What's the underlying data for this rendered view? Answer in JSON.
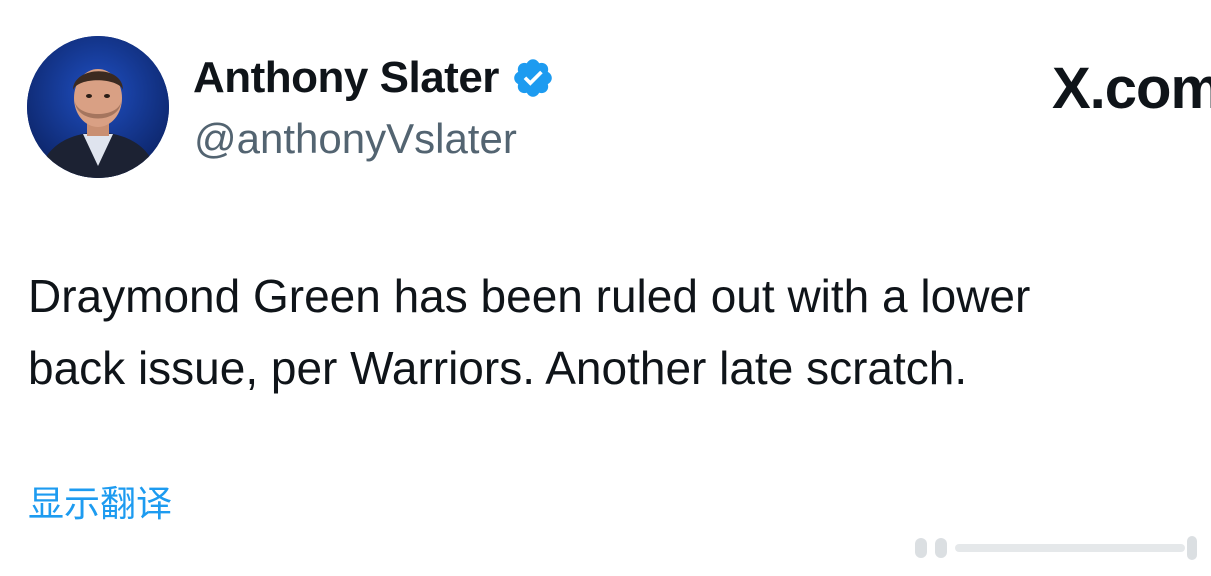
{
  "tweet": {
    "author": {
      "display_name": "Anthony Slater",
      "handle": "@anthonyVslater",
      "verified": true,
      "verified_icon": "verified-badge-icon",
      "avatar_icon": "profile-photo"
    },
    "brand": "X.com",
    "text_lines": [
      "Draymond Green has been ruled out with a lower",
      "back issue, per Warriors. Another late scratch."
    ],
    "translate_label": "显示翻译"
  },
  "colors": {
    "text": "#0f1419",
    "secondary_text": "#536471",
    "link": "#1d9bf0",
    "verified": "#1d9bf0",
    "background": "#ffffff"
  }
}
